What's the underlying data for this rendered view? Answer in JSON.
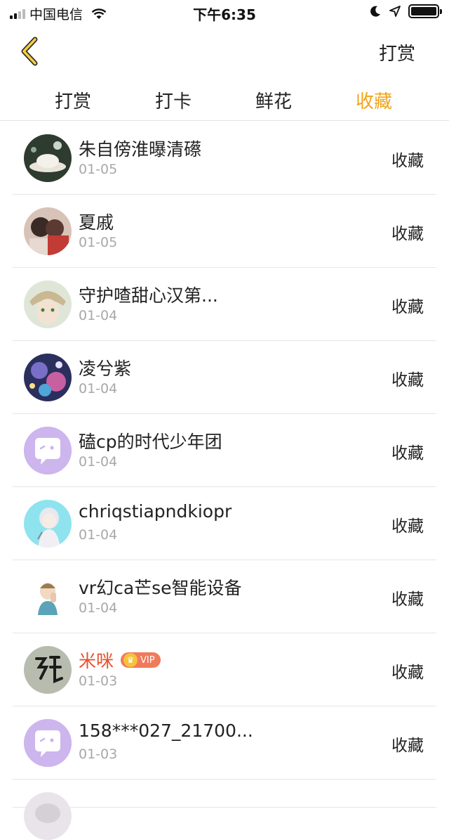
{
  "status_bar": {
    "carrier": "中国电信",
    "time": "下午6:35"
  },
  "nav": {
    "action_label": "打赏"
  },
  "tabs": [
    {
      "label": "打赏",
      "active": false
    },
    {
      "label": "打卡",
      "active": false
    },
    {
      "label": "鲜花",
      "active": false
    },
    {
      "label": "收藏",
      "active": true
    }
  ],
  "colors": {
    "accent": "#f0a419",
    "vip_name": "#e5532f",
    "default_avatar": "#cdb5ee"
  },
  "list": [
    {
      "name": "朱自傍淮曝清礤",
      "date": "01-05",
      "action": "收藏",
      "avatar": "photo-teacup"
    },
    {
      "name": "夏戚",
      "date": "01-05",
      "action": "收藏",
      "avatar": "photo-couple"
    },
    {
      "name": "守护喳甜心汉第...",
      "date": "01-04",
      "action": "收藏",
      "avatar": "photo-anime-boy"
    },
    {
      "name": "凌兮紫",
      "date": "01-04",
      "action": "收藏",
      "avatar": "photo-galaxy"
    },
    {
      "name": "磕cp的时代少年团",
      "date": "01-04",
      "action": "收藏",
      "avatar": "default-chat-icon"
    },
    {
      "name": "chriqstiapndkiopr",
      "date": "01-04",
      "action": "收藏",
      "avatar": "photo-anime-girl"
    },
    {
      "name": "vr幻ca芒se智能设备",
      "date": "01-04",
      "action": "收藏",
      "avatar": "photo-kid"
    },
    {
      "name": "米咪",
      "date": "01-03",
      "action": "收藏",
      "avatar": "photo-calligraphy",
      "vip": true,
      "vip_label": "VIP"
    },
    {
      "name": "158***027_21700...",
      "date": "01-03",
      "action": "收藏",
      "avatar": "default-chat-icon"
    }
  ]
}
